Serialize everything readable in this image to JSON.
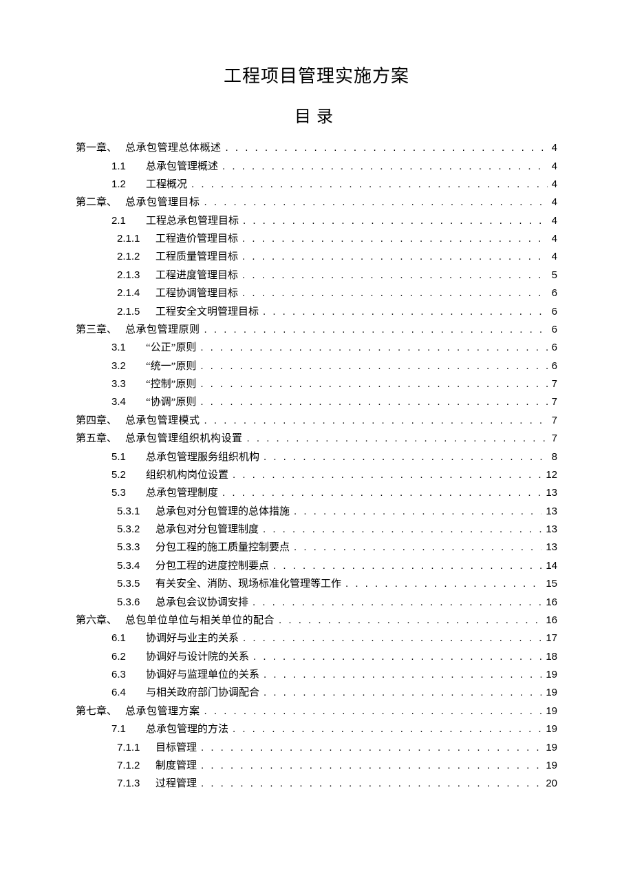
{
  "title_main": "工程项目管理实施方案",
  "title_sub": "目录",
  "toc": [
    {
      "level": 1,
      "num": "第一章、",
      "text": "总承包管理总体概述",
      "page": "4"
    },
    {
      "level": 2,
      "num": "1.1",
      "text": "总承包管理概述",
      "page": "4"
    },
    {
      "level": 2,
      "num": "1.2",
      "text": "工程概况",
      "page": "4"
    },
    {
      "level": 1,
      "num": "第二章、",
      "text": "总承包管理目标",
      "page": "4"
    },
    {
      "level": 2,
      "num": "2.1",
      "text": "工程总承包管理目标",
      "page": "4"
    },
    {
      "level": 3,
      "num": "2.1.1",
      "text": "工程造价管理目标",
      "page": "4"
    },
    {
      "level": 3,
      "num": "2.1.2",
      "text": "工程质量管理目标",
      "page": "4"
    },
    {
      "level": 3,
      "num": "2.1.3",
      "text": "工程进度管理目标",
      "page": "5"
    },
    {
      "level": 3,
      "num": "2.1.4",
      "text": "工程协调管理目标",
      "page": "6"
    },
    {
      "level": 3,
      "num": "2.1.5",
      "text": "工程安全文明管理目标",
      "page": "6"
    },
    {
      "level": 1,
      "num": "第三章、",
      "text": "总承包管理原则",
      "page": "6"
    },
    {
      "level": 2,
      "num": "3.1",
      "text": "“公正”原则",
      "page": "6"
    },
    {
      "level": 2,
      "num": "3.2",
      "text": "“统一”原则",
      "page": "6"
    },
    {
      "level": 2,
      "num": "3.3",
      "text": "“控制”原则",
      "page": "7"
    },
    {
      "level": 2,
      "num": "3.4",
      "text": "“协调”原则",
      "page": "7"
    },
    {
      "level": 1,
      "num": "第四章、",
      "text": "总承包管理模式",
      "page": "7"
    },
    {
      "level": 1,
      "num": "第五章、",
      "text": "总承包管理组织机构设置",
      "page": "7"
    },
    {
      "level": 2,
      "num": "5.1",
      "text": "总承包管理服务组织机构",
      "page": "8"
    },
    {
      "level": 2,
      "num": "5.2",
      "text": "组织机构岗位设置",
      "page": "12"
    },
    {
      "level": 2,
      "num": "5.3",
      "text": "总承包管理制度",
      "page": "13"
    },
    {
      "level": 3,
      "num": "5.3.1",
      "text": "总承包对分包管理的总体措施",
      "page": "13"
    },
    {
      "level": 3,
      "num": "5.3.2",
      "text": "总承包对分包管理制度",
      "page": "13"
    },
    {
      "level": 3,
      "num": "5.3.3",
      "text": "分包工程的施工质量控制要点",
      "page": "13"
    },
    {
      "level": 3,
      "num": "5.3.4",
      "text": "分包工程的进度控制要点",
      "page": "14"
    },
    {
      "level": 3,
      "num": "5.3.5",
      "text": "有关安全、消防、现场标准化管理等工作",
      "page": "15"
    },
    {
      "level": 3,
      "num": "5.3.6",
      "text": "总承包会议协调安排",
      "page": "16"
    },
    {
      "level": 1,
      "num": "第六章、",
      "text": "总包单位单位与相关单位的配合",
      "page": "16"
    },
    {
      "level": 2,
      "num": "6.1",
      "text": "协调好与业主的关系",
      "page": "17"
    },
    {
      "level": 2,
      "num": "6.2",
      "text": "协调好与设计院的关系",
      "page": "18"
    },
    {
      "level": 2,
      "num": "6.3",
      "text": "协调好与监理单位的关系",
      "page": "19"
    },
    {
      "level": 2,
      "num": "6.4",
      "text": "与相关政府部门协调配合",
      "page": "19"
    },
    {
      "level": 1,
      "num": "第七章、",
      "text": "总承包管理方案",
      "page": "19"
    },
    {
      "level": 2,
      "num": "7.1",
      "text": "总承包管理的方法",
      "page": "19"
    },
    {
      "level": 3,
      "num": "7.1.1",
      "text": "目标管理",
      "page": "19"
    },
    {
      "level": 3,
      "num": "7.1.2",
      "text": "制度管理",
      "page": "19"
    },
    {
      "level": 3,
      "num": "7.1.3",
      "text": "过程管理",
      "page": "20"
    }
  ]
}
